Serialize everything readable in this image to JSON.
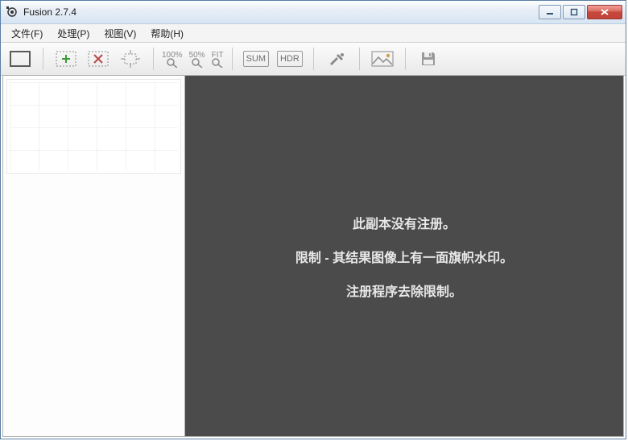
{
  "window": {
    "title": "Fusion 2.7.4"
  },
  "menus": {
    "file": "文件(F)",
    "process": "处理(P)",
    "view": "视图(V)",
    "help": "帮助(H)"
  },
  "toolbar": {
    "zoom100": "100%",
    "zoom50": "50%",
    "zoomFit": "FIT",
    "modeSum": "SUM",
    "modeHdr": "HDR"
  },
  "preview": {
    "line1": "此副本没有注册。",
    "line2": "限制 - 其结果图像上有一面旗帜水印。",
    "line3": "注册程序去除限制。"
  }
}
